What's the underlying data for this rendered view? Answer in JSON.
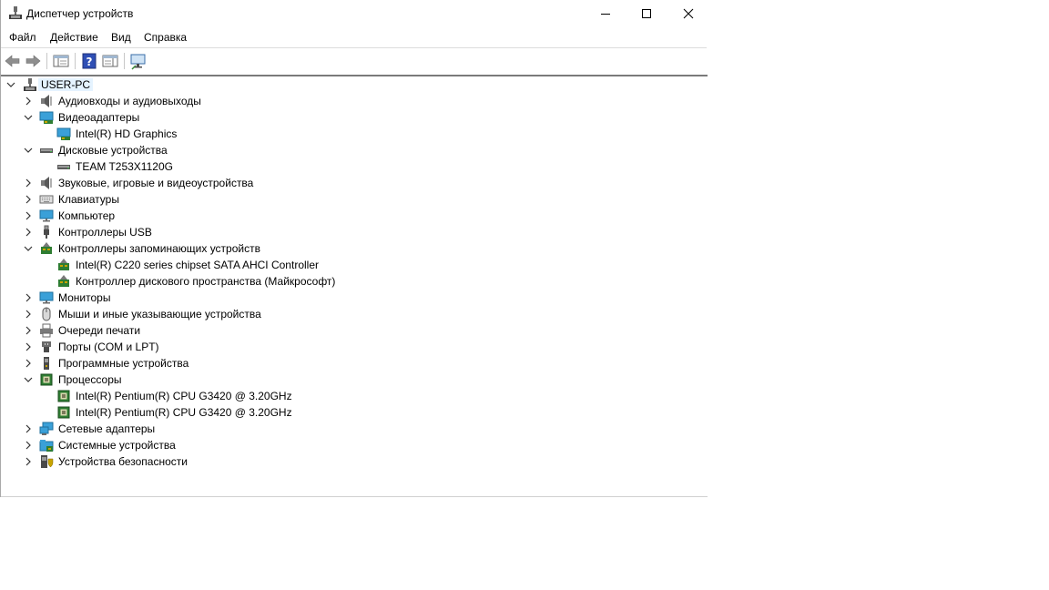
{
  "window": {
    "title": "Диспетчер устройств",
    "buttons": {
      "minimize": "minimize",
      "maximize": "maximize",
      "close": "close"
    }
  },
  "menu": [
    "Файл",
    "Действие",
    "Вид",
    "Справка"
  ],
  "toolbar": [
    "back-icon",
    "forward-icon",
    "properties-view-icon",
    "help-icon",
    "details-view-icon",
    "monitor-scan-icon"
  ],
  "tree": {
    "root": "USER-PC",
    "items": [
      {
        "label": "Аудиовходы и аудиовыходы",
        "icon": "speaker-icon",
        "expanded": false
      },
      {
        "label": "Видеоадаптеры",
        "icon": "display-adapter-icon",
        "expanded": true,
        "children": [
          "Intel(R) HD Graphics"
        ]
      },
      {
        "label": "Дисковые устройства",
        "icon": "disk-drive-icon",
        "expanded": true,
        "children": [
          "TEAM T253X1120G"
        ]
      },
      {
        "label": "Звуковые, игровые и видеоустройства",
        "icon": "speaker-icon",
        "expanded": false
      },
      {
        "label": "Клавиатуры",
        "icon": "keyboard-icon",
        "expanded": false
      },
      {
        "label": "Компьютер",
        "icon": "monitor-icon",
        "expanded": false
      },
      {
        "label": "Контроллеры USB",
        "icon": "usb-icon",
        "expanded": false
      },
      {
        "label": "Контроллеры запоминающих устройств",
        "icon": "storage-controller-icon",
        "expanded": true,
        "children": [
          "Intel(R) C220 series chipset SATA AHCI Controller",
          "Контроллер дискового пространства (Майкрософт)"
        ]
      },
      {
        "label": "Мониторы",
        "icon": "monitor-icon",
        "expanded": false
      },
      {
        "label": "Мыши и иные указывающие устройства",
        "icon": "mouse-icon",
        "expanded": false
      },
      {
        "label": "Очереди печати",
        "icon": "printer-icon",
        "expanded": false
      },
      {
        "label": "Порты (COM и LPT)",
        "icon": "port-icon",
        "expanded": false
      },
      {
        "label": "Программные устройства",
        "icon": "software-device-icon",
        "expanded": false
      },
      {
        "label": "Процессоры",
        "icon": "cpu-icon",
        "expanded": true,
        "children": [
          "Intel(R) Pentium(R) CPU G3420 @ 3.20GHz",
          "Intel(R) Pentium(R) CPU G3420 @ 3.20GHz"
        ]
      },
      {
        "label": "Сетевые адаптеры",
        "icon": "network-icon",
        "expanded": false
      },
      {
        "label": "Системные устройства",
        "icon": "system-folder-icon",
        "expanded": false
      },
      {
        "label": "Устройства безопасности",
        "icon": "security-device-icon",
        "expanded": false
      }
    ]
  }
}
